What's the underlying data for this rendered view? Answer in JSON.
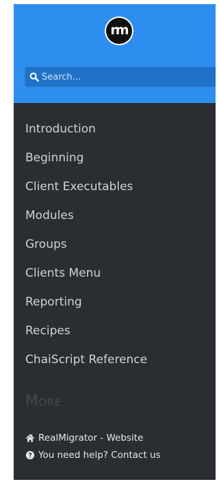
{
  "brand": {
    "logo_text": "rm",
    "accent_color": "#2d8ef0"
  },
  "search": {
    "placeholder": "Search...",
    "icon": "search-icon"
  },
  "nav": {
    "items": [
      {
        "label": "Introduction"
      },
      {
        "label": "Beginning"
      },
      {
        "label": "Client Executables"
      },
      {
        "label": "Modules"
      },
      {
        "label": "Groups"
      },
      {
        "label": "Clients Menu"
      },
      {
        "label": "Reporting"
      },
      {
        "label": "Recipes"
      },
      {
        "label": "ChaiScript Reference"
      }
    ]
  },
  "more": {
    "heading": "More",
    "links": [
      {
        "label": "RealMigrator - Website",
        "icon": "home-icon"
      },
      {
        "label": "You need help? Contact us",
        "icon": "question-circle-icon"
      }
    ]
  }
}
